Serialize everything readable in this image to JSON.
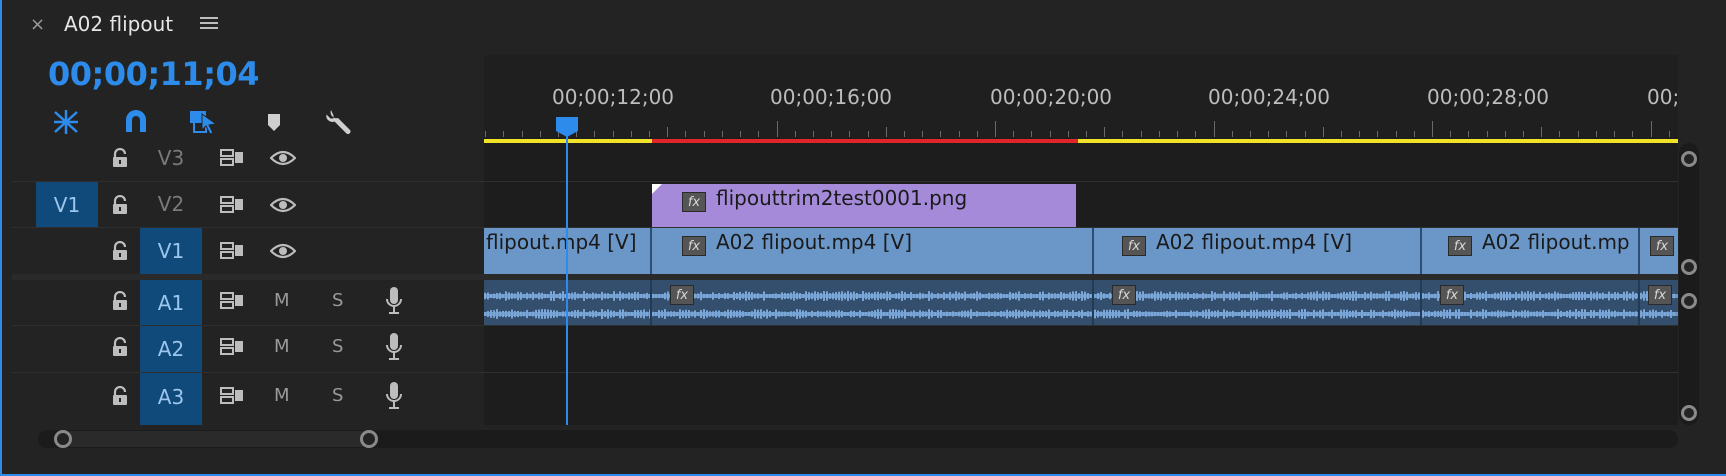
{
  "panel": {
    "title": "A02 flipout",
    "close_glyph": "×",
    "timecode": "00;00;11;04"
  },
  "toolbar": {
    "tools": [
      {
        "name": "insert-overwrite-icon",
        "active": true
      },
      {
        "name": "snap-magnet-icon",
        "active": true
      },
      {
        "name": "linked-selection-icon",
        "active": true
      },
      {
        "name": "add-marker-icon",
        "active": false
      },
      {
        "name": "timeline-settings-wrench-icon",
        "active": false
      }
    ]
  },
  "ruler": {
    "labels": [
      "00;00;12;00",
      "00;00;16;00",
      "00;00;20;00",
      "00;00;24;00",
      "00;00;28;00",
      "00;"
    ]
  },
  "tracks": {
    "source_patch": "V1",
    "video": [
      {
        "name": "V3",
        "targeted": false
      },
      {
        "name": "V2",
        "targeted": false
      },
      {
        "name": "V1",
        "targeted": true
      }
    ],
    "audio": [
      {
        "name": "A1",
        "mute": "M",
        "solo": "S"
      },
      {
        "name": "A2",
        "mute": "M",
        "solo": "S"
      },
      {
        "name": "A3",
        "mute": "M",
        "solo": "S"
      }
    ]
  },
  "clips": {
    "fx_label": "fx",
    "v2": [
      {
        "name": "flipouttrim2test0001.png"
      }
    ],
    "v1": [
      {
        "name": "flipout.mp4 [V]"
      },
      {
        "name": "A02 flipout.mp4 [V]"
      },
      {
        "name": "A02 flipout.mp4 [V]"
      },
      {
        "name": "A02 flipout.mp"
      },
      {
        "name": ""
      }
    ]
  },
  "colors": {
    "accent": "#2d8ceb",
    "workarea_yellow": "#f1e32a",
    "render_red": "#e0262b",
    "video_clip": "#6a96c8",
    "still_clip": "#a48ad8",
    "audio_clip": "#344e6e"
  }
}
